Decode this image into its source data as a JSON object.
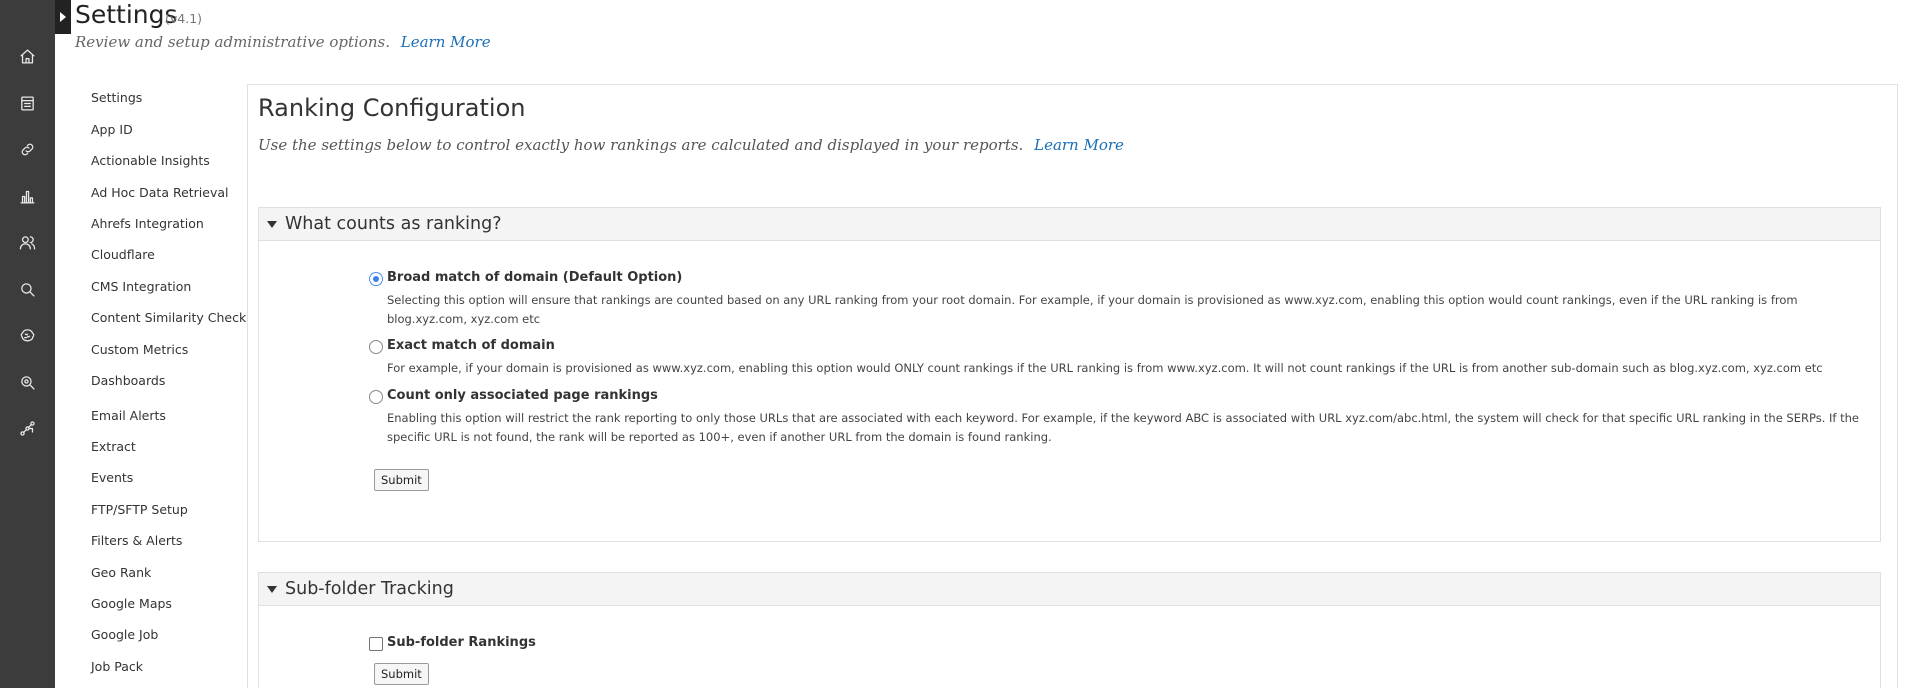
{
  "header": {
    "title": "Settings",
    "version": "(v4.1)",
    "description": "Review and setup administrative options.",
    "learn_more": "Learn More"
  },
  "rail": {
    "icons": [
      "home-icon",
      "document-icon",
      "link-icon",
      "bar-chart-icon",
      "users-icon",
      "search-icon",
      "brain-icon",
      "search-gear-icon",
      "workflow-icon"
    ]
  },
  "menu": {
    "items": [
      "Settings",
      "App ID",
      "Actionable Insights",
      "Ad Hoc Data Retrieval",
      "Ahrefs Integration",
      "Cloudflare",
      "CMS Integration",
      "Content Similarity Check",
      "Custom Metrics",
      "Dashboards",
      "Email Alerts",
      "Extract",
      "Events",
      "FTP/SFTP Setup",
      "Filters & Alerts",
      "Geo Rank",
      "Google Maps",
      "Google Job",
      "Job Pack"
    ]
  },
  "main": {
    "title": "Ranking Configuration",
    "description": "Use the settings below to control exactly how rankings are calculated and displayed in your reports.",
    "learn_more": "Learn More",
    "ranking_section": {
      "title": "What counts as ranking?",
      "options": [
        {
          "label": "Broad match of domain (Default Option)",
          "description": "Selecting this option will ensure that rankings are counted based on any URL ranking from your root domain. For example, if your domain is provisioned as www.xyz.com, enabling this option would count rankings, even if the URL ranking is from blog.xyz.com, xyz.com etc",
          "checked": true
        },
        {
          "label": "Exact match of domain",
          "description": "For example, if your domain is provisioned as www.xyz.com, enabling this option would ONLY count rankings if the URL ranking is from www.xyz.com. It will not count rankings if the URL is from another sub-domain such as blog.xyz.com, xyz.com etc",
          "checked": false
        },
        {
          "label": "Count only associated page rankings",
          "description": "Enabling this option will restrict the rank reporting to only those URLs that are associated with each keyword. For example, if the keyword ABC is associated with URL xyz.com/abc.html, the system will check for that specific URL ranking in the SERPs. If the specific URL is not found, the rank will be reported as 100+, even if another URL from the domain is found ranking.",
          "checked": false
        }
      ],
      "submit_label": "Submit"
    },
    "subfolder_section": {
      "title": "Sub-folder Tracking",
      "checkbox_label": "Sub-folder Rankings",
      "checked": false,
      "submit_label": "Submit"
    }
  },
  "colors": {
    "rail_bg": "#3c3c3c",
    "link": "#1a6fb7",
    "radio_selected": "#3b82e6"
  }
}
